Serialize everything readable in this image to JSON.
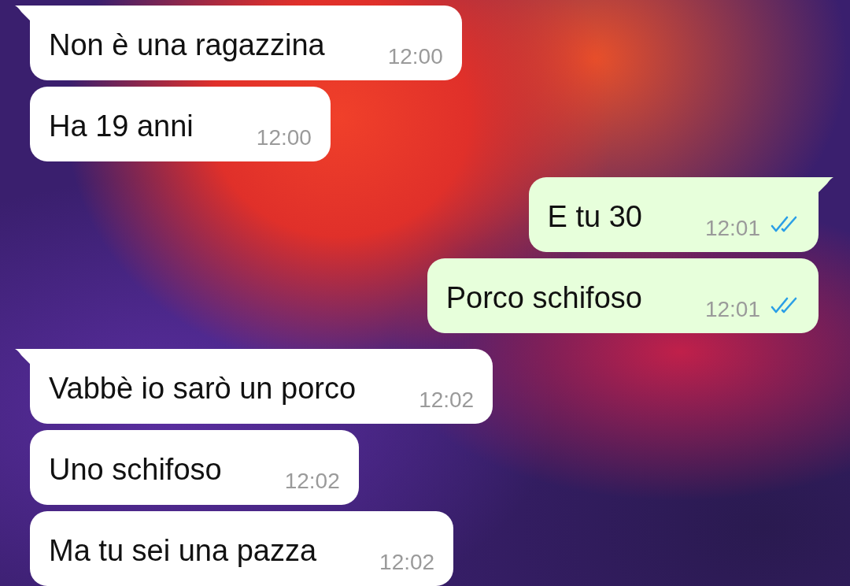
{
  "messages": [
    {
      "kind": "incoming",
      "tail": true,
      "text": "Non è una ragazzina",
      "time": "12:00"
    },
    {
      "kind": "incoming",
      "tail": false,
      "text": "Ha 19 anni",
      "time": "12:00"
    },
    {
      "kind": "outgoing",
      "tail": true,
      "text": "E tu 30",
      "time": "12:01",
      "read": true
    },
    {
      "kind": "outgoing",
      "tail": false,
      "text": "Porco schifoso",
      "time": "12:01",
      "read": true
    },
    {
      "kind": "incoming",
      "tail": true,
      "text": "Vabbè io sarò un porco",
      "time": "12:02"
    },
    {
      "kind": "incoming",
      "tail": false,
      "text": "Uno schifoso",
      "time": "12:02"
    },
    {
      "kind": "incoming",
      "tail": false,
      "text": "Ma tu sei una pazza",
      "time": "12:02"
    }
  ]
}
